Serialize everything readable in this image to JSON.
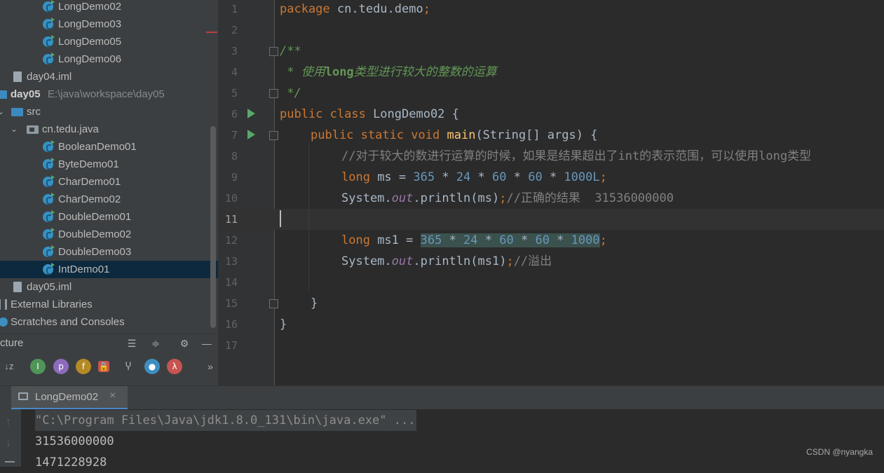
{
  "project_tree": {
    "items": [
      {
        "label": "LongDemo02",
        "type": "class"
      },
      {
        "label": "LongDemo03",
        "type": "class"
      },
      {
        "label": "LongDemo05",
        "type": "class"
      },
      {
        "label": "LongDemo06",
        "type": "class"
      },
      {
        "label": "day04.iml",
        "type": "file"
      },
      {
        "label": "day05",
        "path": "E:\\java\\workspace\\day05",
        "type": "module"
      },
      {
        "label": "src",
        "type": "folder"
      },
      {
        "label": "cn.tedu.java",
        "type": "package"
      },
      {
        "label": "BooleanDemo01",
        "type": "class"
      },
      {
        "label": "ByteDemo01",
        "type": "class"
      },
      {
        "label": "CharDemo01",
        "type": "class"
      },
      {
        "label": "CharDemo02",
        "type": "class"
      },
      {
        "label": "DoubleDemo01",
        "type": "class"
      },
      {
        "label": "DoubleDemo02",
        "type": "class"
      },
      {
        "label": "DoubleDemo03",
        "type": "class"
      },
      {
        "label": "IntDemo01",
        "type": "class",
        "selected": true
      },
      {
        "label": "day05.iml",
        "type": "file"
      },
      {
        "label": "External Libraries",
        "type": "library"
      },
      {
        "label": "Scratches and Consoles",
        "type": "scratch"
      }
    ]
  },
  "structure_panel": {
    "title": "cture",
    "more": "»"
  },
  "editor": {
    "current_line": 11,
    "line_numbers": [
      "1",
      "2",
      "3",
      "4",
      "5",
      "6",
      "7",
      "8",
      "9",
      "10",
      "11",
      "12",
      "13",
      "14",
      "15",
      "16",
      "17"
    ],
    "lines": {
      "l1_kw": "package",
      "l1_rest": " cn.tedu.demo",
      "l1_semi": ";",
      "l3": "/**",
      "l4_pre": " * 使用",
      "l4_tag": "long",
      "l4_post": "类型进行较大的整数的运算",
      "l5": " */",
      "l6_kw": "public class",
      "l6_rest": " LongDemo02 {",
      "l7_kw": "public static void",
      "l7_fn": "main",
      "l7_rest": "(String[] args) {",
      "l8": "//对于较大的数进行运算的时候，如果是结果超出了int的表示范围，可以使用long类型",
      "l9_kw": "long",
      "l9_var": " ms = ",
      "l9_n1": "365",
      "l9_op1": " * ",
      "l9_n2": "24",
      "l9_op2": " * ",
      "l9_n3": "60",
      "l9_op3": " * ",
      "l9_n4": "60",
      "l9_op4": " * ",
      "l9_n5": "1000L",
      "l9_semi": ";",
      "l10_pre": "System.",
      "l10_fld": "out",
      "l10_call": ".println(ms)",
      "l10_semi": ";",
      "l10_cm": "//正确的结果  31536000000",
      "l12_kw": "long",
      "l12_var": " ms1 = ",
      "l12_n1": "365",
      "l12_op1": " * ",
      "l12_n2": "24",
      "l12_op2": " * ",
      "l12_n3": "60",
      "l12_op3": " * ",
      "l12_n4": "60",
      "l12_op4": " * ",
      "l12_n5": "1000",
      "l12_semi": ";",
      "l13_pre": "System.",
      "l13_fld": "out",
      "l13_call": ".println(ms1)",
      "l13_semi": ";",
      "l13_cm": "//溢出",
      "l15": "}",
      "l16": "}"
    }
  },
  "run_panel": {
    "tab_label": "LongDemo02",
    "close_glyph": "×",
    "output": [
      "\"C:\\Program Files\\Java\\jdk1.8.0_131\\bin\\java.exe\" ...",
      "31536000000",
      "1471228928"
    ]
  },
  "watermark": "CSDN @nyangka",
  "colors": {
    "keyword": "#cc7832",
    "number": "#6897bb",
    "comment": "#808080",
    "doc_comment": "#629755",
    "function": "#ffc66d",
    "field": "#9876aa",
    "selection": "#0d293e"
  }
}
